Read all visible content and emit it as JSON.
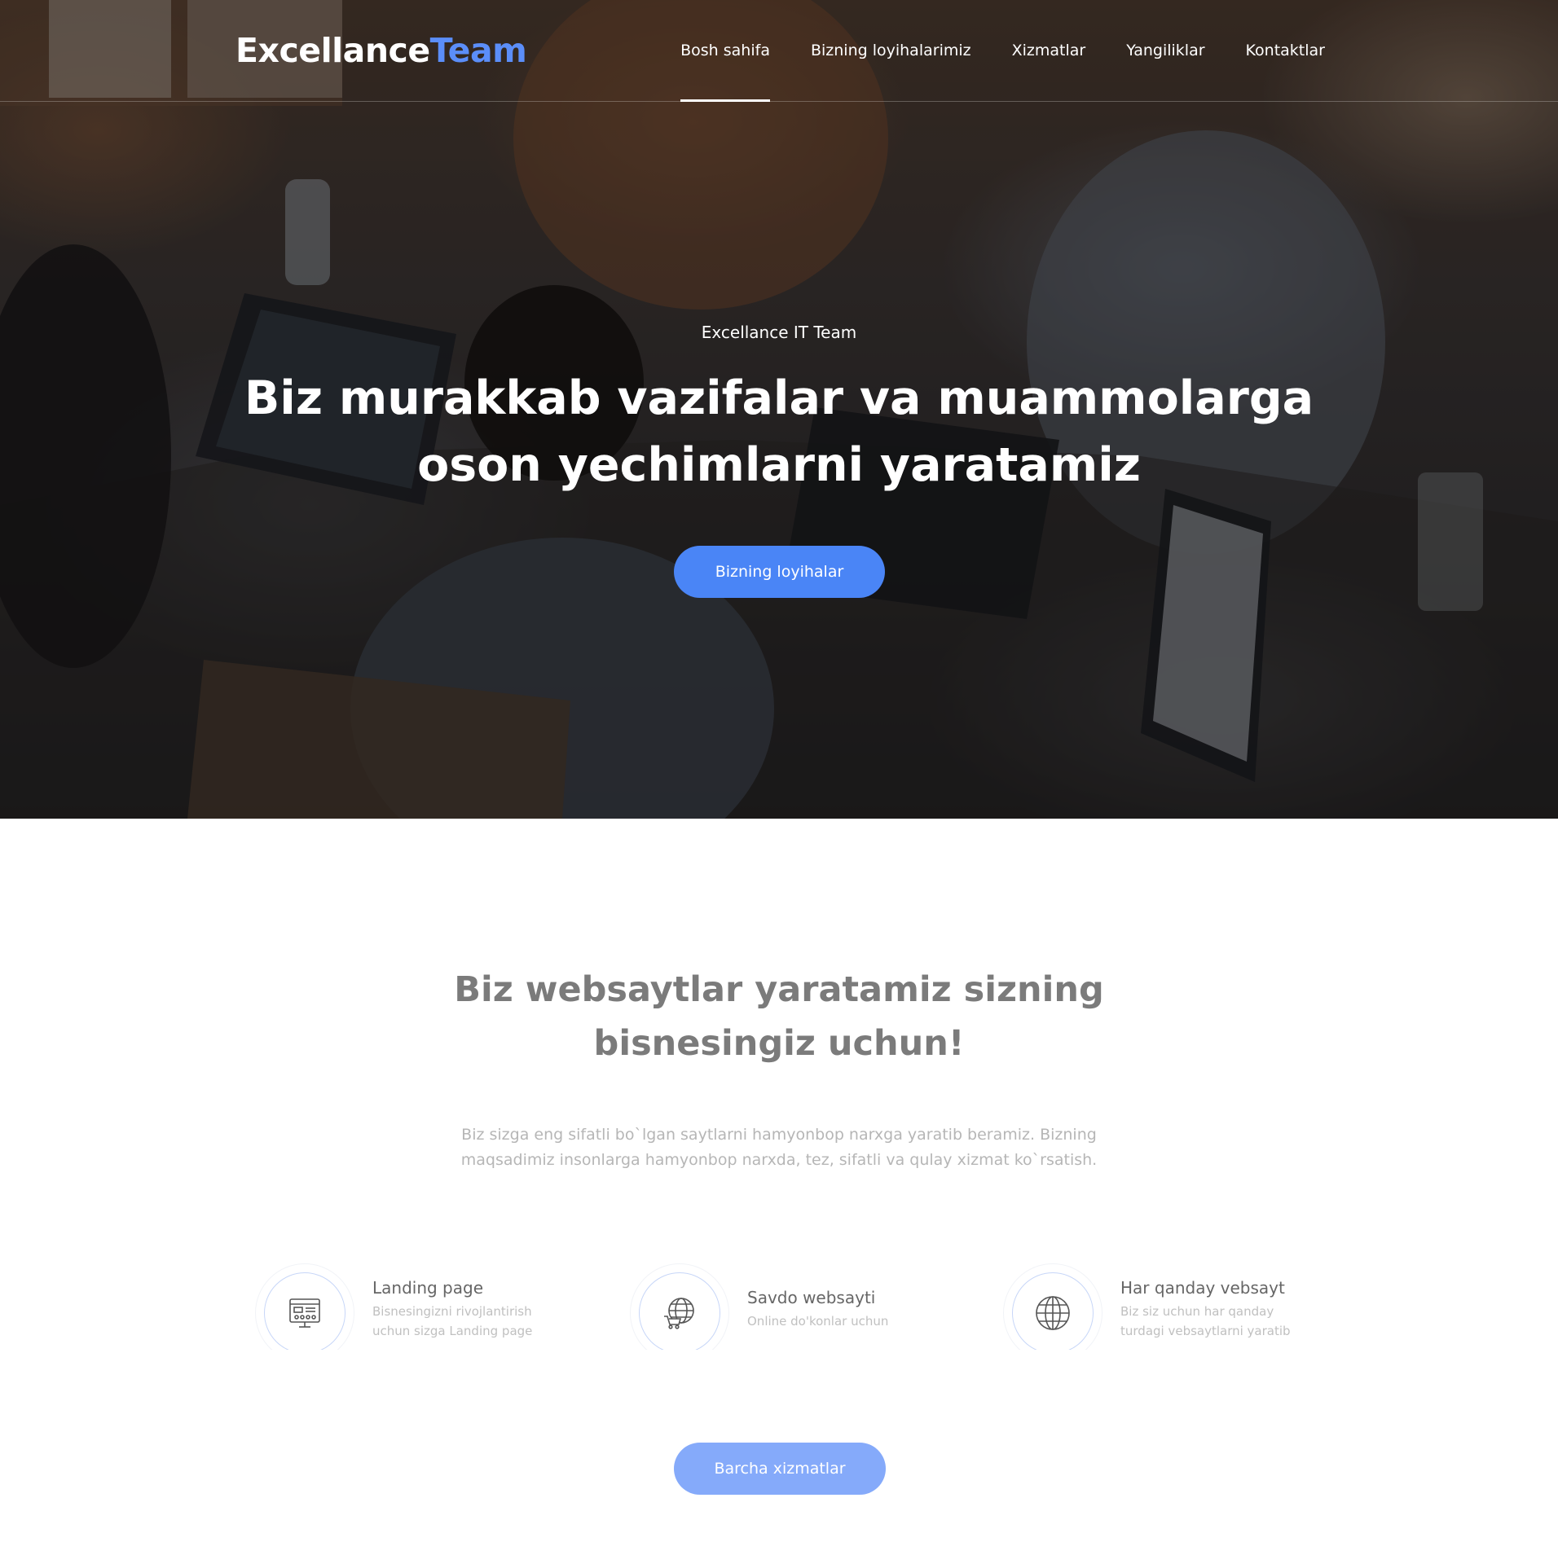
{
  "nav": {
    "logo_main": "Excellance",
    "logo_accent": "Team",
    "items": [
      {
        "label": "Bosh sahifa"
      },
      {
        "label": "Bizning loyihalarimiz"
      },
      {
        "label": "Xizmatlar"
      },
      {
        "label": "Yangiliklar"
      },
      {
        "label": "Kontaktlar"
      }
    ]
  },
  "hero": {
    "subtitle": "Excellance IT Team",
    "title_line1": "Biz murakkab vazifalar va muammolarga",
    "title_line2": "oson yechimlarni yaratamiz",
    "button_label": "Bizning loyihalar"
  },
  "services": {
    "title_line1": "Biz websaytlar yaratamiz sizning",
    "title_line2": "bisnesingiz uchun!",
    "text_line1": "Biz sizga eng sifatli bo`lgan saytlarni hamyonbop narxga yaratib beramiz. Bizning",
    "text_line2": "maqsadimiz insonlarga hamyonbop narxda, tez, sifatli va qulay xizmat ko`rsatish.",
    "features": [
      {
        "title": "Landing page",
        "desc_line1": "Bisnesingizni rivojlantirish",
        "desc_line2": "uchun sizga Landing page",
        "icon": "browser-window-icon"
      },
      {
        "title": "Savdo websayti",
        "desc_line1": "Online do'konlar uchun",
        "icon": "globe-cart-icon"
      },
      {
        "title": "Har qanday vebsayt",
        "desc_line1": "Biz siz uchun har qanday",
        "desc_line2": "turdagi vebsaytlarni yaratib",
        "icon": "globe-icon"
      }
    ],
    "button_label": "Barcha xizmatlar"
  },
  "colors": {
    "accent": "#4a85f6",
    "accent_light": "#85aafa",
    "logo_accent": "#5b8ef9"
  }
}
